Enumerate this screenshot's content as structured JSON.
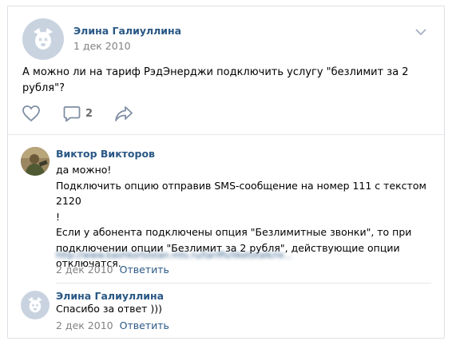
{
  "post": {
    "author": "Элина Галиуллина",
    "date": "1 дек 2010",
    "text": "А можно ли на тариф РэдЭнерджи подключить услугу \"безлимит за 2 рубля\"?",
    "comments_count": "2"
  },
  "comments": [
    {
      "author": "Виктор Викторов",
      "lines": [
        "да можно!",
        "Подключить опцию отправив SMS-сообщение на номер 111 с текстом 2120",
        "!",
        "Если у абонента подключены опция \"Безлимитные звонки\", то при",
        "подключении опции \"Безлимит за 2 рубля\", действующие опции",
        "отключатся."
      ],
      "link": "http://www.bashkortostan.mts.ru/tariffs/liketotalk/re...",
      "date": "2 дек 2010",
      "reply_label": "Ответить"
    },
    {
      "author": "Элина Галиуллина",
      "text": "Спасибо за ответ )))",
      "date": "2 дек 2010",
      "reply_label": "Ответить"
    }
  ],
  "icons": {
    "more": "chevron-down-icon",
    "like": "heart-icon",
    "comment": "comment-icon",
    "share": "share-icon"
  },
  "colors": {
    "link": "#2a5885",
    "muted": "#828282",
    "icon": "#7f8fa4"
  }
}
